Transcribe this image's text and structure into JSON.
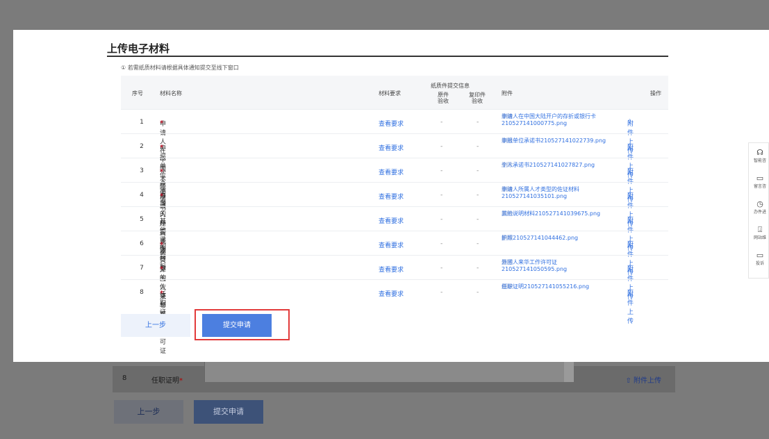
{
  "modal": {
    "title": "上传电子材料",
    "hint": "① 若需纸质材料请根据具体通知提交至线下窗口",
    "columns": {
      "index": "序号",
      "name": "材料名称",
      "requirement": "材料要求",
      "paper_group": "纸质件提交信息",
      "original": "原件\n验收",
      "copy": "复印件\n验收",
      "attachment": "附件",
      "operation": "操作"
    },
    "rows": [
      {
        "index": "1",
        "name": "申请人在中国大陆开户的存折或银行卡",
        "required": "*",
        "req_link": "查看要求",
        "orig": "-",
        "copy": "-",
        "attachment": "申请人在中国大陆开户的存折或银行卡210527141000775.png",
        "delete": "删除",
        "upload": "附件上传"
      },
      {
        "index": "2",
        "name": "申报单位承诺书",
        "required": "*",
        "req_link": "查看要求",
        "orig": "-",
        "copy": "-",
        "attachment": "申报单位承诺书210527141022739.png",
        "delete": "删除",
        "upload": "附件上传"
      },
      {
        "index": "3",
        "name": "个人承诺书",
        "required": "*",
        "req_link": "查看要求",
        "orig": "-",
        "copy": "-",
        "attachment": "个人承诺书210527141027827.png",
        "delete": "删除",
        "upload": "附件上传"
      },
      {
        "index": "4",
        "name": "申请人所属人才类型的佐证材料",
        "required": "*",
        "req_link": "查看要求",
        "orig": "-",
        "copy": "-",
        "attachment": "申请人所属人才类型的佐证材料210527141035101.png",
        "delete": "删除",
        "upload": "附件上传"
      },
      {
        "index": "5",
        "name": "其他说明材料",
        "required": "",
        "req_link": "查看要求",
        "orig": "-",
        "copy": "-",
        "attachment": "其他说明材料210527141039675.png",
        "delete": "删除",
        "upload": "附件上传"
      },
      {
        "index": "6",
        "name": "护照",
        "required": "*",
        "req_link": "查看要求",
        "orig": "-",
        "copy": "-",
        "attachment": "护照210527141044462.png",
        "delete": "删除",
        "upload": "附件上传"
      },
      {
        "index": "7",
        "name": "外国人来华工作许可证",
        "required": "*",
        "req_link": "查看要求",
        "orig": "-",
        "copy": "-",
        "attachment": "外国人来华工作许可证210527141050595.png",
        "delete": "删除",
        "upload": "附件上传"
      },
      {
        "index": "8",
        "name": "任职证明",
        "required": "*",
        "req_link": "查看要求",
        "orig": "-",
        "copy": "-",
        "attachment": "任职证明210527141055216.png",
        "delete": "删除",
        "upload": "附件上传"
      }
    ],
    "prev_label": "上一步",
    "submit_label": "提交申请"
  },
  "background": {
    "row_index": "8",
    "row_name": "任职证明",
    "row_star": "*",
    "row_upload": "附件上传",
    "prev_label": "上一步",
    "submit_label": "提交申请"
  },
  "float_bar": [
    {
      "icon": "headset-icon",
      "glyph": "☊",
      "label": "智能咨"
    },
    {
      "icon": "message-icon",
      "glyph": "▭",
      "label": "留言咨"
    },
    {
      "icon": "clock-icon",
      "glyph": "◷",
      "label": "办件进"
    },
    {
      "icon": "download-icon",
      "glyph": "⍗",
      "label": "网站维"
    },
    {
      "icon": "complaint-icon",
      "glyph": "▭",
      "label": "投诉"
    }
  ],
  "colors": {
    "accent": "#4c7fe0",
    "link": "#2f6fe0",
    "highlight": "#e23a3a",
    "required": "#d9001b"
  }
}
